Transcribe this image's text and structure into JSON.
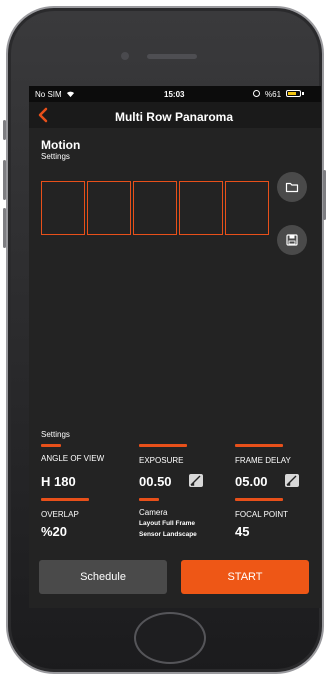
{
  "status_bar": {
    "carrier": "No SIM",
    "time": "15:03",
    "battery_text": "%61",
    "battery_level": 0.61
  },
  "nav": {
    "title": "Multi Row Panaroma",
    "back_icon": "chevron-left-icon"
  },
  "motion": {
    "title": "Motion",
    "subtitle": "Settings",
    "frame_count": 5,
    "side_buttons": [
      "folder-icon",
      "save-icon"
    ]
  },
  "settings": {
    "label": "Settings",
    "params": [
      {
        "label": "ANGLE OF VIEW",
        "value": "H 180"
      },
      {
        "label": "EXPOSURE",
        "value": "00.50"
      },
      {
        "label": "FRAME DELAY",
        "value": "05.00"
      },
      {
        "label": "OVERLAP",
        "value": "%20"
      },
      {
        "label": "Camera",
        "sub1": "Layout Full Frame",
        "sub2": "Sensor Landscape"
      },
      {
        "label": "FOCAL POINT",
        "value": "45"
      }
    ]
  },
  "actions": {
    "schedule_label": "Schedule",
    "start_label": "START"
  },
  "colors": {
    "accent": "#e8501a",
    "start_button": "#ee5716",
    "screen_bg": "#232323",
    "secondary_button": "#4a4a4a"
  }
}
